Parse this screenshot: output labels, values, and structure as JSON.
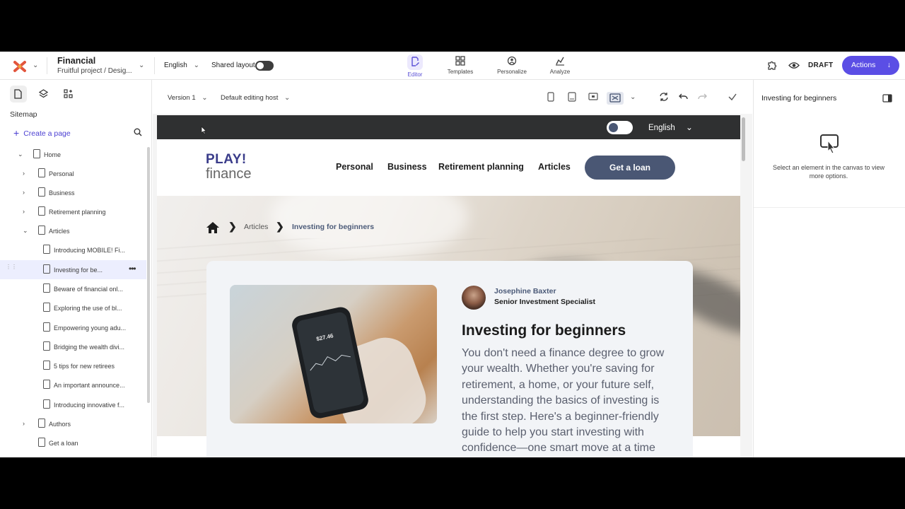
{
  "topbar": {
    "project_name": "Financial",
    "project_sub": "Fruitful project / Desig...",
    "language": "English",
    "shared_layout_label": "Shared layout",
    "modes": [
      {
        "label": "Editor",
        "icon": "editor-icon"
      },
      {
        "label": "Templates",
        "icon": "templates-icon"
      },
      {
        "label": "Personalize",
        "icon": "personalize-icon"
      },
      {
        "label": "Analyze",
        "icon": "analyze-icon"
      }
    ],
    "status": "DRAFT",
    "actions_label": "Actions",
    "accent_color": "#5b4ee5"
  },
  "sidebar": {
    "title": "Sitemap",
    "create_label": "Create a page",
    "tree": [
      {
        "label": "Home"
      },
      {
        "label": "Personal"
      },
      {
        "label": "Business"
      },
      {
        "label": "Retirement planning"
      },
      {
        "label": "Articles"
      },
      {
        "label": "Introducing MOBILE! Fi..."
      },
      {
        "label": "Investing for be..."
      },
      {
        "label": "Beware of financial onl..."
      },
      {
        "label": "Exploring the use of bl..."
      },
      {
        "label": "Empowering young adu..."
      },
      {
        "label": "Bridging the wealth divi..."
      },
      {
        "label": "5 tips for new retirees"
      },
      {
        "label": "An important announce..."
      },
      {
        "label": "Introducing innovative f..."
      },
      {
        "label": "Authors"
      },
      {
        "label": "Get a loan"
      }
    ]
  },
  "canvas": {
    "version_label": "Version 1",
    "host_label": "Default editing host"
  },
  "site": {
    "language": "English",
    "brand_top": "PLAY!",
    "brand_bottom": "finance",
    "nav": [
      "Personal",
      "Business",
      "Retirement planning",
      "Articles"
    ],
    "cta": "Get a loan",
    "breadcrumb": [
      "Articles",
      "Investing for beginners"
    ],
    "author_name": "Josephine Baxter",
    "author_role": "Senior Investment Specialist",
    "article_title": "Investing for beginners",
    "article_body": "You don't need a finance degree to grow your wealth. Whether you're saving for retirement, a home, or your future self, understanding the basics of investing is the first step. Here's a beginner-friendly guide to help you start investing with confidence—one smart move at a time",
    "phone_amount": "$27.46"
  },
  "panel": {
    "title": "Investing for beginners",
    "message": "Select an element in the canvas to view more options."
  }
}
